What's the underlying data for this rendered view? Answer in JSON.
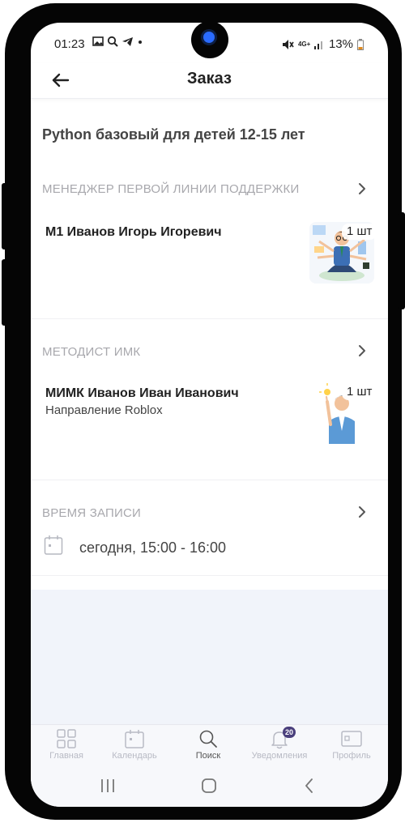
{
  "status_bar": {
    "time": "01:23",
    "network": "4G+",
    "battery": "13%"
  },
  "app_bar": {
    "title": "Заказ"
  },
  "order": {
    "course_title": "Python базовый для детей 12-15 лет"
  },
  "sections": [
    {
      "header": "МЕНЕДЖЕР ПЕРВОЙ ЛИНИИ ПОДДЕРЖКИ",
      "name": "М1 Иванов Игорь Игоревич",
      "subtitle": "",
      "quantity": "1 шт"
    },
    {
      "header": "МЕТОДИСТ ИМК",
      "name": "МИМК Иванов Иван Иванович",
      "subtitle": "Направление Roblox",
      "quantity": "1 шт"
    },
    {
      "header": "ВРЕМЯ ЗАПИСИ",
      "time": "сегодня, 15:00 - 16:00"
    }
  ],
  "bottom_nav": {
    "items": [
      {
        "label": "Главная",
        "icon": "grid-icon"
      },
      {
        "label": "Календарь",
        "icon": "calendar-icon"
      },
      {
        "label": "Поиск",
        "icon": "search-icon"
      },
      {
        "label": "Уведомления",
        "icon": "bell-icon",
        "badge": "20"
      },
      {
        "label": "Профиль",
        "icon": "profile-card-icon"
      }
    ],
    "active_index": 2
  },
  "colors": {
    "accent_badge": "#4a3f7c",
    "section_header": "#a8a8ad",
    "background_gray": "#f1f4fa"
  }
}
